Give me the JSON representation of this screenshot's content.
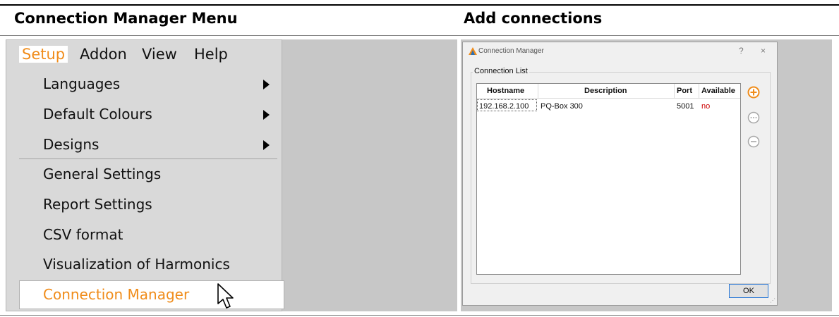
{
  "headings": {
    "left": "Connection Manager Menu",
    "right": "Add connections"
  },
  "menubar": [
    "Setup",
    "Addon",
    "View",
    "Help"
  ],
  "menu_items": [
    {
      "label": "Languages",
      "submenu": true
    },
    {
      "label": "Default Colours",
      "submenu": true
    },
    {
      "label": "Designs",
      "submenu": true
    },
    {
      "label": "General Settings",
      "submenu": false
    },
    {
      "label": "Report Settings",
      "submenu": false
    },
    {
      "label": "CSV format",
      "submenu": false
    },
    {
      "label": "Visualization of Harmonics",
      "submenu": false
    },
    {
      "label": "Connection Manager",
      "submenu": false,
      "highlighted": true
    }
  ],
  "dialog": {
    "title": "Connection Manager",
    "help": "?",
    "close": "×",
    "group_label": "Connection List",
    "columns": [
      "Hostname",
      "Description",
      "Port",
      "Available"
    ],
    "rows": [
      {
        "hostname": "192.168.2.100",
        "description": "PQ-Box 300",
        "port": "5001",
        "available": "no"
      }
    ],
    "ok_label": "OK",
    "icons": [
      "add-icon",
      "edit-icon",
      "remove-icon"
    ]
  },
  "colors": {
    "accent_orange": "#f08c1a",
    "unavailable_red": "#cc0000",
    "ok_border_blue": "#2a78d6"
  }
}
